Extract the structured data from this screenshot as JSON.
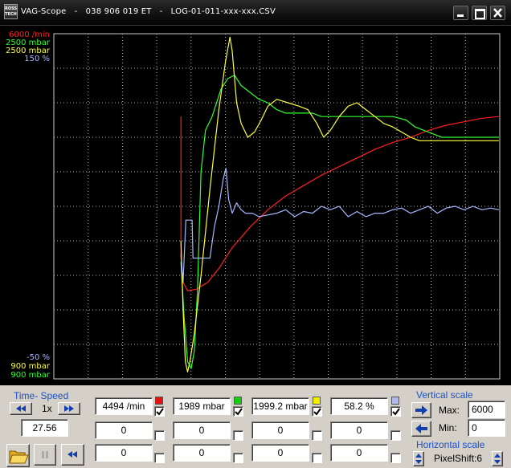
{
  "window": {
    "title": "VAG-Scope   -   038 906 019 ET   -   LOG-01-011-xxx-xxx.CSV",
    "app_icon_text": "Ross Tech"
  },
  "scope": {
    "scale_labels_top": [
      {
        "text": "6000 /min",
        "color": "#ff2020"
      },
      {
        "text": "2500 mbar",
        "color": "#30ff30"
      },
      {
        "text": "2500 mbar",
        "color": "#ffff40"
      },
      {
        "text": "150 %",
        "color": "#a8b8ff"
      }
    ],
    "scale_labels_bottom": [
      {
        "text": "-50 %",
        "color": "#a8b8ff"
      },
      {
        "text": "900 mbar",
        "color": "#ffff40"
      },
      {
        "text": "900 mbar",
        "color": "#30ff30"
      }
    ],
    "grid": true,
    "grid_divisions": {
      "x": 13,
      "y": 10
    },
    "traces": [
      {
        "color": "#ff2020",
        "points": [
          [
            0.285,
            0.24
          ],
          [
            0.285,
            0.65
          ],
          [
            0.29,
            0.72
          ],
          [
            0.3,
            0.745
          ],
          [
            0.32,
            0.74
          ],
          [
            0.345,
            0.72
          ],
          [
            0.37,
            0.68
          ],
          [
            0.4,
            0.62
          ],
          [
            0.44,
            0.56
          ],
          [
            0.48,
            0.51
          ],
          [
            0.52,
            0.47
          ],
          [
            0.56,
            0.44
          ],
          [
            0.6,
            0.41
          ],
          [
            0.64,
            0.385
          ],
          [
            0.68,
            0.36
          ],
          [
            0.72,
            0.335
          ],
          [
            0.76,
            0.315
          ],
          [
            0.8,
            0.3
          ],
          [
            0.84,
            0.28
          ],
          [
            0.88,
            0.265
          ],
          [
            0.92,
            0.255
          ],
          [
            0.96,
            0.245
          ],
          [
            0.998,
            0.24
          ]
        ]
      },
      {
        "color": "#30ff30",
        "points": [
          [
            0.285,
            0.66
          ],
          [
            0.292,
            0.82
          ],
          [
            0.3,
            0.95
          ],
          [
            0.308,
            0.97
          ],
          [
            0.315,
            0.92
          ],
          [
            0.322,
            0.75
          ],
          [
            0.33,
            0.4
          ],
          [
            0.34,
            0.28
          ],
          [
            0.355,
            0.24
          ],
          [
            0.375,
            0.16
          ],
          [
            0.39,
            0.13
          ],
          [
            0.405,
            0.12
          ],
          [
            0.42,
            0.15
          ],
          [
            0.44,
            0.17
          ],
          [
            0.46,
            0.19
          ],
          [
            0.48,
            0.2
          ],
          [
            0.5,
            0.22
          ],
          [
            0.52,
            0.23
          ],
          [
            0.54,
            0.23
          ],
          [
            0.56,
            0.23
          ],
          [
            0.58,
            0.23
          ],
          [
            0.6,
            0.24
          ],
          [
            0.64,
            0.24
          ],
          [
            0.68,
            0.24
          ],
          [
            0.72,
            0.24
          ],
          [
            0.76,
            0.24
          ],
          [
            0.79,
            0.25
          ],
          [
            0.81,
            0.27
          ],
          [
            0.83,
            0.28
          ],
          [
            0.85,
            0.29
          ],
          [
            0.87,
            0.3
          ],
          [
            0.9,
            0.3
          ],
          [
            0.95,
            0.3
          ],
          [
            0.998,
            0.3
          ]
        ]
      },
      {
        "color": "#ffff40",
        "points": [
          [
            0.285,
            0.6
          ],
          [
            0.29,
            0.8
          ],
          [
            0.295,
            0.95
          ],
          [
            0.3,
            0.98
          ],
          [
            0.305,
            0.95
          ],
          [
            0.315,
            0.87
          ],
          [
            0.33,
            0.7
          ],
          [
            0.35,
            0.45
          ],
          [
            0.37,
            0.22
          ],
          [
            0.385,
            0.08
          ],
          [
            0.395,
            0.01
          ],
          [
            0.4,
            0.05
          ],
          [
            0.41,
            0.2
          ],
          [
            0.42,
            0.26
          ],
          [
            0.435,
            0.3
          ],
          [
            0.45,
            0.285
          ],
          [
            0.465,
            0.25
          ],
          [
            0.48,
            0.21
          ],
          [
            0.5,
            0.19
          ],
          [
            0.525,
            0.2
          ],
          [
            0.55,
            0.21
          ],
          [
            0.57,
            0.22
          ],
          [
            0.59,
            0.26
          ],
          [
            0.605,
            0.3
          ],
          [
            0.62,
            0.28
          ],
          [
            0.64,
            0.24
          ],
          [
            0.66,
            0.21
          ],
          [
            0.68,
            0.2
          ],
          [
            0.7,
            0.22
          ],
          [
            0.72,
            0.24
          ],
          [
            0.74,
            0.26
          ],
          [
            0.76,
            0.27
          ],
          [
            0.78,
            0.285
          ],
          [
            0.8,
            0.3
          ],
          [
            0.82,
            0.31
          ],
          [
            0.84,
            0.31
          ],
          [
            0.87,
            0.31
          ],
          [
            0.9,
            0.31
          ],
          [
            0.95,
            0.31
          ],
          [
            0.998,
            0.31
          ]
        ]
      },
      {
        "color": "#a8b8ff",
        "points": [
          [
            0.285,
            0.64
          ],
          [
            0.29,
            0.72
          ],
          [
            0.296,
            0.54
          ],
          [
            0.31,
            0.54
          ],
          [
            0.312,
            0.65
          ],
          [
            0.33,
            0.65
          ],
          [
            0.35,
            0.65
          ],
          [
            0.36,
            0.56
          ],
          [
            0.37,
            0.5
          ],
          [
            0.38,
            0.42
          ],
          [
            0.386,
            0.39
          ],
          [
            0.392,
            0.48
          ],
          [
            0.4,
            0.52
          ],
          [
            0.41,
            0.49
          ],
          [
            0.42,
            0.51
          ],
          [
            0.43,
            0.52
          ],
          [
            0.445,
            0.52
          ],
          [
            0.46,
            0.53
          ],
          [
            0.48,
            0.525
          ],
          [
            0.5,
            0.52
          ],
          [
            0.52,
            0.51
          ],
          [
            0.54,
            0.53
          ],
          [
            0.56,
            0.515
          ],
          [
            0.58,
            0.52
          ],
          [
            0.6,
            0.5
          ],
          [
            0.62,
            0.51
          ],
          [
            0.64,
            0.5
          ],
          [
            0.66,
            0.53
          ],
          [
            0.68,
            0.515
          ],
          [
            0.7,
            0.53
          ],
          [
            0.72,
            0.52
          ],
          [
            0.74,
            0.52
          ],
          [
            0.76,
            0.51
          ],
          [
            0.78,
            0.505
          ],
          [
            0.8,
            0.52
          ],
          [
            0.82,
            0.51
          ],
          [
            0.84,
            0.5
          ],
          [
            0.86,
            0.52
          ],
          [
            0.88,
            0.505
          ],
          [
            0.9,
            0.5
          ],
          [
            0.92,
            0.51
          ],
          [
            0.94,
            0.5
          ],
          [
            0.96,
            0.51
          ],
          [
            0.98,
            0.505
          ],
          [
            0.998,
            0.51
          ]
        ]
      }
    ]
  },
  "panel": {
    "time_speed": {
      "label": "Time- Speed",
      "speed": "1x",
      "time_value": "27.56"
    },
    "channels": [
      {
        "value": "4494 /min",
        "color": "#e81010",
        "checked": true,
        "offset": "0",
        "extra": "0"
      },
      {
        "value": "1989 mbar",
        "color": "#10d010",
        "checked": true,
        "offset": "0",
        "extra": "0"
      },
      {
        "value": "1999.2 mbar",
        "color": "#f0f000",
        "checked": true,
        "offset": "0",
        "extra": "0"
      },
      {
        "value": "58.2 %",
        "color": "#b0b8f0",
        "checked": true,
        "offset": "0",
        "extra": "0"
      }
    ],
    "vertical_scale": {
      "label": "Vertical scale",
      "max_label": "Max:",
      "max_value": "6000",
      "min_label": "Min:",
      "min_value": "0"
    },
    "horizontal_scale": {
      "label": "Horizontal scale",
      "pixel_shift": "PixelShift:6"
    }
  }
}
